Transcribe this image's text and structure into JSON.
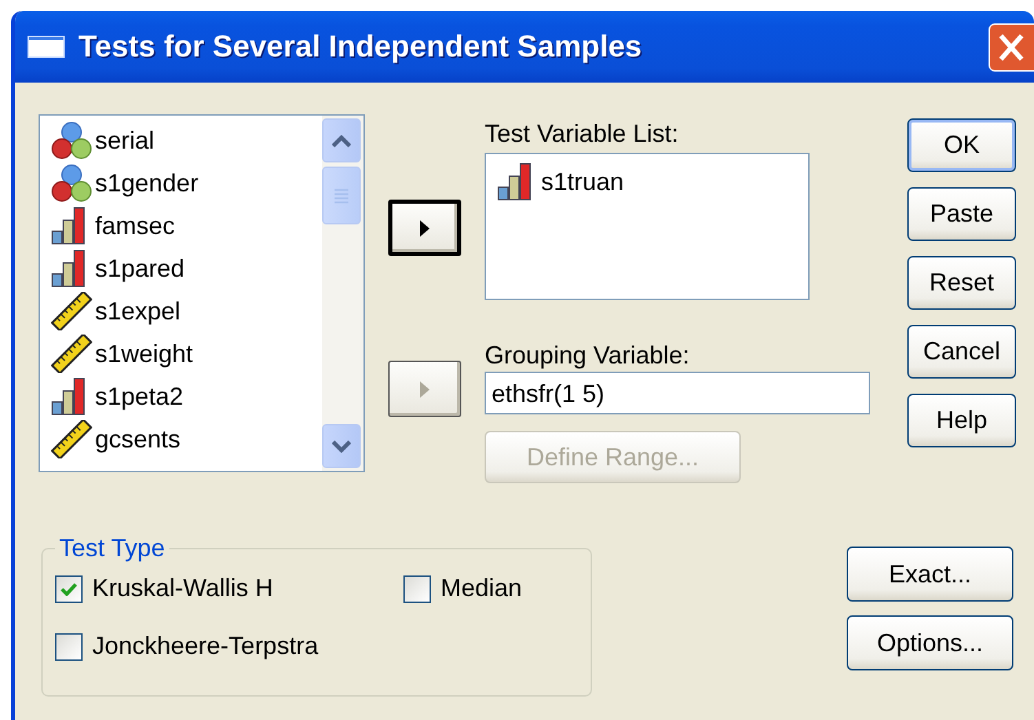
{
  "window": {
    "title": "Tests for Several Independent Samples"
  },
  "source_list": {
    "items": [
      {
        "name": "serial",
        "kind": "nominal"
      },
      {
        "name": "s1gender",
        "kind": "nominal"
      },
      {
        "name": "famsec",
        "kind": "ordinal"
      },
      {
        "name": "s1pared",
        "kind": "ordinal"
      },
      {
        "name": "s1expel",
        "kind": "scale"
      },
      {
        "name": "s1weight",
        "kind": "scale"
      },
      {
        "name": "s1peta2",
        "kind": "ordinal"
      },
      {
        "name": "gcsents",
        "kind": "scale"
      }
    ]
  },
  "move_buttons": [
    {
      "disabled": false,
      "focused": true
    },
    {
      "disabled": true,
      "focused": false
    }
  ],
  "test_variable_list": {
    "label": "Test Variable List:",
    "items": [
      {
        "name": "s1truan",
        "kind": "ordinal"
      }
    ]
  },
  "grouping_variable": {
    "label": "Grouping Variable:",
    "value": "ethsfr(1 5)"
  },
  "define_range": {
    "label": "Define Range...",
    "disabled": true
  },
  "buttons": [
    {
      "label": "OK",
      "default": true
    },
    {
      "label": "Paste",
      "default": false
    },
    {
      "label": "Reset",
      "default": false
    },
    {
      "label": "Cancel",
      "default": false
    },
    {
      "label": "Help",
      "default": false
    }
  ],
  "test_type": {
    "title": "Test Type",
    "options": [
      {
        "label": "Kruskal-Wallis H",
        "checked": true
      },
      {
        "label": "Median",
        "checked": false
      },
      {
        "label": "Jonckheere-Terpstra",
        "checked": false
      }
    ]
  },
  "extra_buttons": [
    {
      "label": "Exact..."
    },
    {
      "label": "Options..."
    }
  ]
}
